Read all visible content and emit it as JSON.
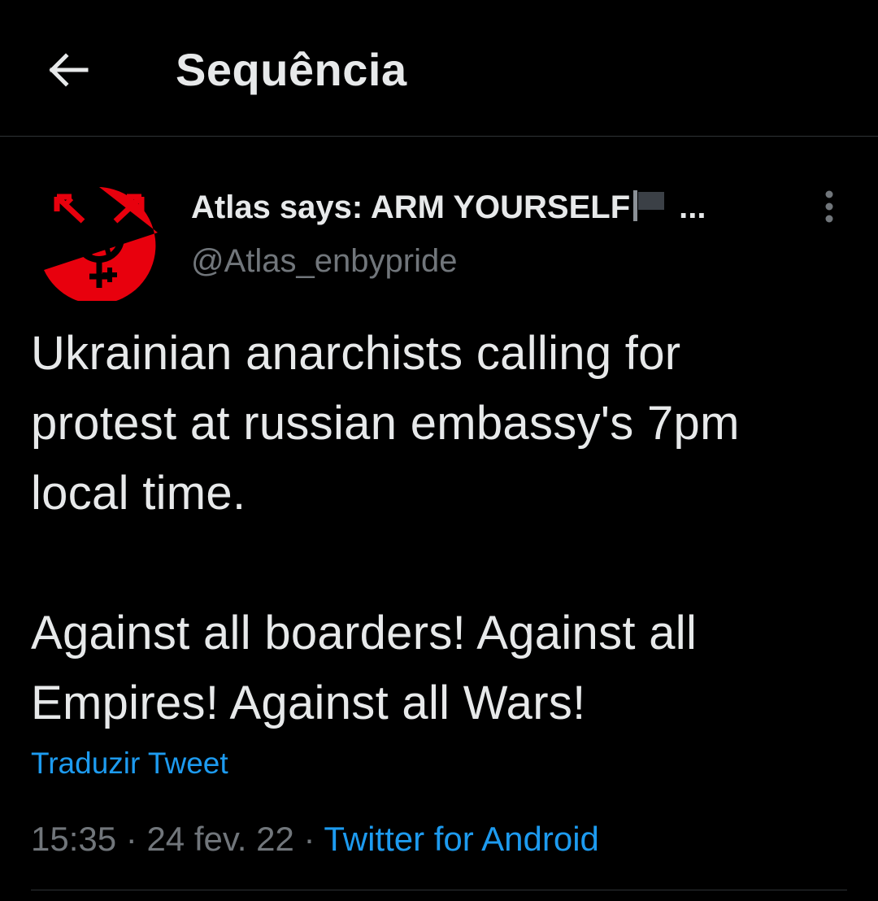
{
  "header": {
    "title": "Sequência",
    "back_icon": "arrow-left-icon"
  },
  "tweet": {
    "author": {
      "display_name": "Atlas says: ARM YOURSELF",
      "name_flag_icon": "black-flag-emoji-icon",
      "name_truncation": "...",
      "handle": "@Atlas_enbypride",
      "avatar_icon": "anarcho-queer-symbol-avatar-icon",
      "avatar_color": "#e8000d"
    },
    "more_icon": "vertical-ellipsis-icon",
    "text_lines": [
      "Ukrainian anarchists calling for",
      "protest at russian embassy's 7pm",
      "local time."
    ],
    "text_lines_2": [
      "Against all boarders! Against all",
      "Empires! Against all Wars!"
    ],
    "translate_label": "Traduzir Tweet",
    "time": "15:35",
    "separator": "·",
    "date": "24 fev. 22",
    "source": "Twitter for Android"
  },
  "colors": {
    "background": "#000000",
    "text_primary": "#e7e9ea",
    "text_secondary": "#71767b",
    "link": "#1d9bf0",
    "divider": "#2f3336"
  }
}
